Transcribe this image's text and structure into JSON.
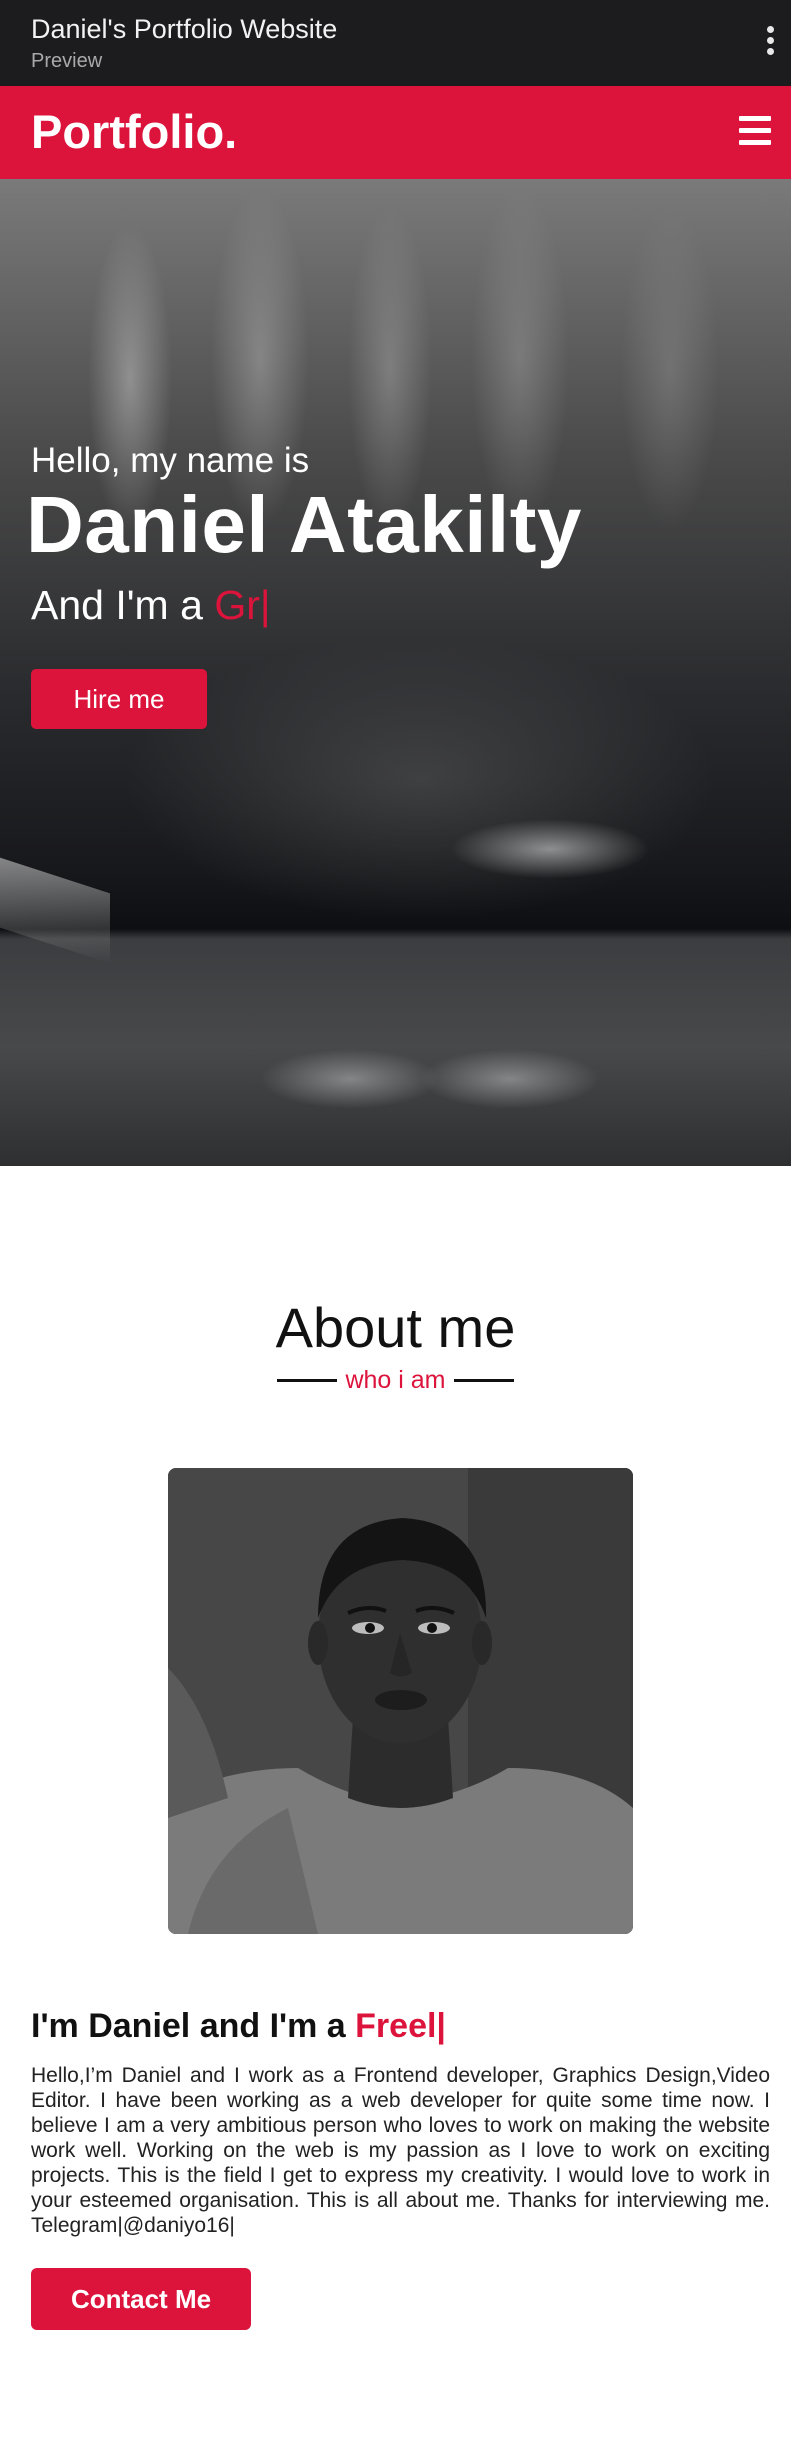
{
  "appbar": {
    "title": "Daniel's Portfolio Website",
    "subtitle": "Preview",
    "menu_icon": "more-vert-icon"
  },
  "nav": {
    "logo": "Portfolio.",
    "menu_icon": "hamburger-menu-icon"
  },
  "hero": {
    "greeting": "Hello, my name is",
    "name": "Daniel Atakilty",
    "role_prefix": "And I'm a ",
    "role_typed": "Gr|",
    "hire_button": "Hire me"
  },
  "about": {
    "title": "About me",
    "subtitle": "who i am",
    "photo_icon": "profile-photo",
    "intro_prefix": "I'm Daniel and I'm a ",
    "intro_typed": "Freel|",
    "bio": "Hello,I’m Daniel and I work as a Frontend developer, Graphics Design,Video Editor. I have been working as a web developer for quite some time now. I believe I am a very ambitious person who loves to work on making the website work well. Working on the web is my passion as I love to work on exciting projects. This is the field I get to express my creativity. I would love to work in your esteemed organisation. This is all about me. Thanks for interviewing me. Telegram|@daniyo16|",
    "contact_button": "Contact Me"
  },
  "colors": {
    "accent": "#dc143c",
    "appbar_bg": "#1c1c1e",
    "text": "#111111"
  }
}
